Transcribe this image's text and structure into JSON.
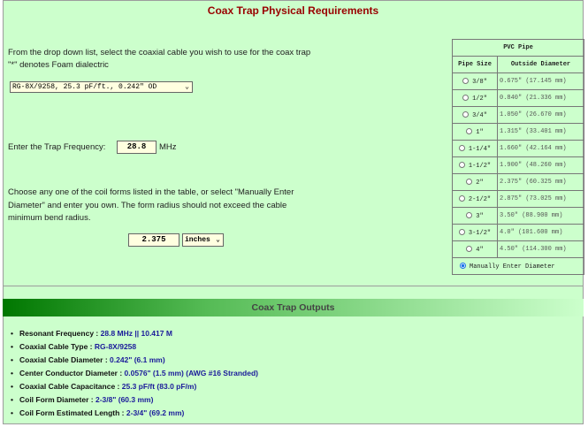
{
  "title": "Coax Trap Physical Requirements",
  "intro": {
    "line1": "From the drop down list, select the coaxial cable you wish to use for the coax trap",
    "line2": "\"*\" denotes Foam dialectric"
  },
  "cable_select": {
    "value": "RG-8X/9258, 25.3 pF/ft., 0.242\" OD"
  },
  "frequency": {
    "label": "Enter the Trap Frequency:",
    "value": "28.8",
    "unit": "MHz"
  },
  "coil_text": {
    "line1": "Choose any one of the coil forms listed in the table, or select \"Manually Enter",
    "line2": "Diameter\" and enter you own. The form radius should not exceed the cable",
    "line3": "minimum bend radius."
  },
  "diameter": {
    "value": "2.375",
    "unit": "inches"
  },
  "pvc_table": {
    "title": "PVC Pipe",
    "col_size": "Pipe Size",
    "col_od": "Outside Diameter",
    "rows": [
      {
        "size": "3/8\"",
        "od": "0.675\" (17.145 mm)"
      },
      {
        "size": "1/2\"",
        "od": "0.840\" (21.336 mm)"
      },
      {
        "size": "3/4\"",
        "od": "1.050\" (26.670 mm)"
      },
      {
        "size": "1\"",
        "od": "1.315\" (33.401 mm)"
      },
      {
        "size": "1-1/4\"",
        "od": "1.660\" (42.164 mm)"
      },
      {
        "size": "1-1/2\"",
        "od": "1.900\" (48.260 mm)"
      },
      {
        "size": "2\"",
        "od": "2.375\" (60.325 mm)"
      },
      {
        "size": "2-1/2\"",
        "od": "2.875\" (73.025 mm)"
      },
      {
        "size": "3\"",
        "od": "3.50\" (88.900 mm)"
      },
      {
        "size": "3-1/2\"",
        "od": "4.0\" (101.600 mm)"
      },
      {
        "size": "4\"",
        "od": "4.50\" (114.300 mm)"
      }
    ],
    "manual_label": "Manually Enter Diameter",
    "manual_selected": true
  },
  "outputs": {
    "title": "Coax Trap Outputs",
    "items": [
      {
        "label": "Resonant Frequency :",
        "value": "28.8 MHz || 10.417 M"
      },
      {
        "label": "Coaxial Cable Type :",
        "value": "RG-8X/9258"
      },
      {
        "label": "Coaxial Cable Diameter :",
        "value": "0.242\" (6.1 mm)"
      },
      {
        "label": "Center Conductor Diameter :",
        "value": "0.0576\" (1.5 mm) (AWG #16 Stranded)"
      },
      {
        "label": "Coaxial Cable Capacitance :",
        "value": "25.3 pF/ft (83.0 pF/m)"
      },
      {
        "label": "Coil Form Diameter :",
        "value": "2-3/8\" (60.3 mm)"
      },
      {
        "label": "Coil Form Estimated Length :",
        "value": "2-3/4\" (69.2 mm)"
      }
    ]
  },
  "colors": {
    "background": "#ccffcc",
    "title": "#990000",
    "value": "#1a1a9a",
    "input": "#ffffe0"
  }
}
